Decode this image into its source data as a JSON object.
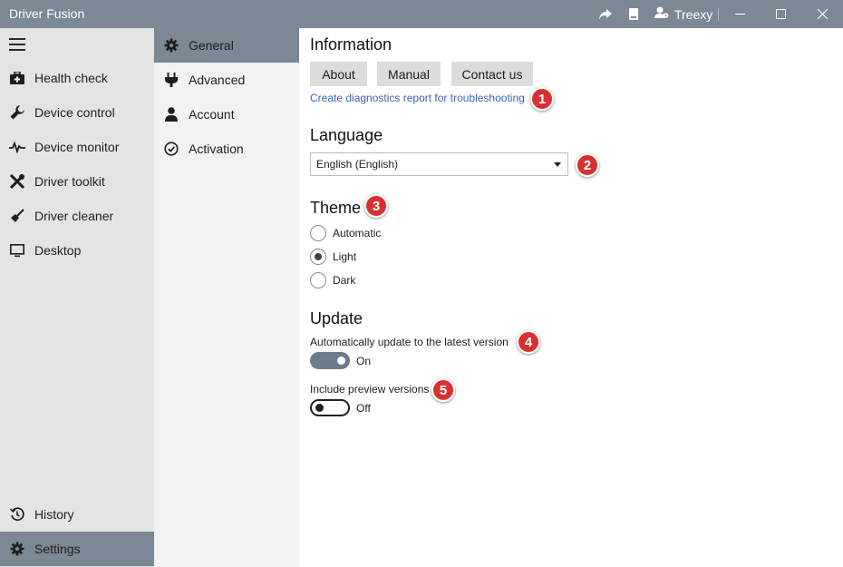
{
  "window": {
    "title": "Driver Fusion",
    "user": "Treexy",
    "accent": "#7b8896"
  },
  "nav": {
    "items": [
      {
        "label": "Health check",
        "icon": "medkit-icon"
      },
      {
        "label": "Device control",
        "icon": "wrench-icon"
      },
      {
        "label": "Device monitor",
        "icon": "pulse-icon"
      },
      {
        "label": "Driver toolkit",
        "icon": "tools-icon"
      },
      {
        "label": "Driver cleaner",
        "icon": "broom-icon"
      },
      {
        "label": "Desktop",
        "icon": "monitor-icon"
      }
    ],
    "bottom": [
      {
        "label": "History",
        "icon": "history-icon"
      },
      {
        "label": "Settings",
        "icon": "gear-icon",
        "active": true
      }
    ]
  },
  "subnav": {
    "items": [
      {
        "label": "General",
        "icon": "gear-icon",
        "active": true
      },
      {
        "label": "Advanced",
        "icon": "plug-icon"
      },
      {
        "label": "Account",
        "icon": "person-icon"
      },
      {
        "label": "Activation",
        "icon": "check-circle-icon"
      }
    ]
  },
  "information": {
    "heading": "Information",
    "buttons": [
      "About",
      "Manual",
      "Contact us"
    ],
    "diagnostics_link": "Create diagnostics report for troubleshooting"
  },
  "language": {
    "heading": "Language",
    "selected": "English (English)"
  },
  "theme": {
    "heading": "Theme",
    "options": [
      "Automatic",
      "Light",
      "Dark"
    ],
    "selected": "Light"
  },
  "update": {
    "heading": "Update",
    "auto_update_label": "Automatically update to the latest version",
    "auto_update_state": "On",
    "preview_label": "Include preview versions",
    "preview_state": "Off"
  },
  "callouts": [
    "1",
    "2",
    "3",
    "4",
    "5"
  ],
  "colors": {
    "callout": "#d83030",
    "link": "#3a63b8",
    "toggle_on": "#6c7c8e"
  }
}
